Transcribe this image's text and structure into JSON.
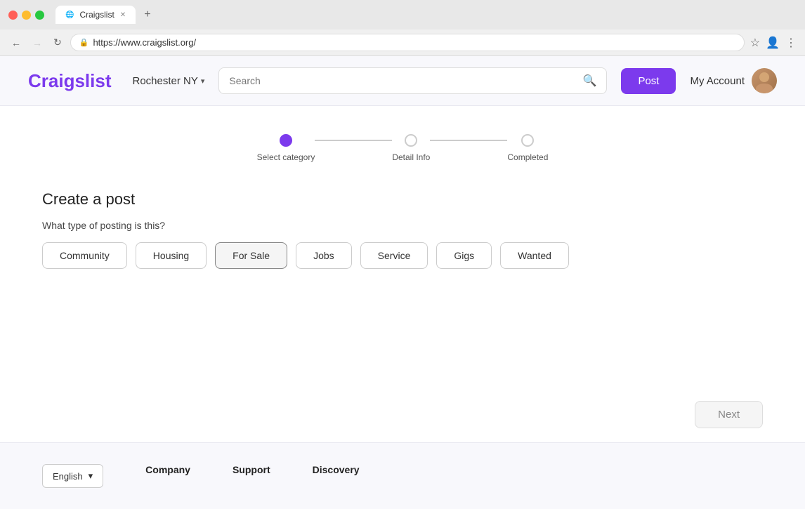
{
  "browser": {
    "dots": [
      "red",
      "yellow",
      "green"
    ],
    "tab_title": "Craigslist",
    "tab_favicon": "🔵",
    "address": "https://www.craigslist.org/",
    "new_tab_label": "+"
  },
  "header": {
    "logo": "Craigslist",
    "location": "Rochester NY",
    "search_placeholder": "Search",
    "post_label": "Post",
    "my_account_label": "My Account"
  },
  "stepper": {
    "step1_label": "Select category",
    "step2_label": "Detail Info",
    "step3_label": "Completed"
  },
  "create_post": {
    "title": "Create a post",
    "question": "What type of posting is this?",
    "categories": [
      "Community",
      "Housing",
      "For Sale",
      "Jobs",
      "Service",
      "Gigs",
      "Wanted"
    ]
  },
  "next_button": "Next",
  "footer": {
    "language": "English",
    "company_title": "Company",
    "support_title": "Support",
    "discovery_title": "Discovery"
  }
}
